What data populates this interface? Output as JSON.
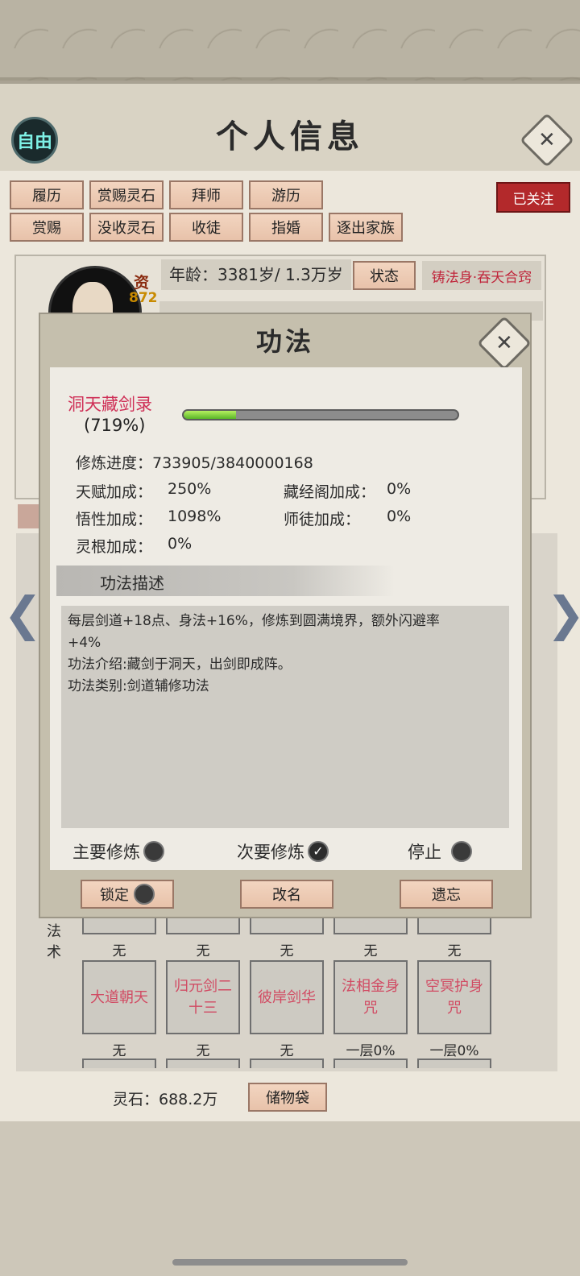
{
  "header": {
    "mode_badge": "自由",
    "title": "个人信息"
  },
  "actions": {
    "row1": [
      "履历",
      "赏赐灵石",
      "拜师",
      "游历"
    ],
    "row2": [
      "赏赐",
      "没收灵石",
      "收徒",
      "指婚",
      "逐出家族"
    ],
    "followed": "已关注"
  },
  "profile": {
    "zi_label": "资",
    "zi_value": "872",
    "age": "年龄：3381岁/ 1.3万岁",
    "status_button": "状态",
    "realm": "铸法身·吞天合窍"
  },
  "dialog": {
    "title": "功法",
    "skill_name": "洞天藏剑录",
    "skill_percent": "(719%)",
    "progress_fraction": 0.19,
    "stats": {
      "progress": "修炼进度：733905/3840000168",
      "talent": "天赋加成：",
      "talent_val": "250%",
      "library": "藏经阁加成：",
      "library_val": "0%",
      "insight": "悟性加成：",
      "insight_val": "1098%",
      "mentor": "师徒加成：",
      "mentor_val": "0%",
      "root": "灵根加成：",
      "root_val": "0%"
    },
    "description_header": "功法描述",
    "description_lines": [
      "每层剑道+18点、身法+16%，修炼到圆满境界，额外闪避率",
      "+4%",
      "功法介绍:藏剑于洞天，出剑即成阵。",
      "功法类别:剑道辅修功法"
    ],
    "modes": {
      "primary": "主要修炼",
      "secondary": "次要修炼",
      "stop": "停止",
      "selected": "secondary"
    },
    "buttons": {
      "lock": "锁定",
      "rename": "改名",
      "forget": "遗忘"
    }
  },
  "skills_grid": {
    "label": "法术",
    "row0_captions": [
      "无",
      "无",
      "无",
      "无",
      "无"
    ],
    "row1": [
      {
        "name": "大道朝天",
        "caption": "无"
      },
      {
        "name": "归元剑二十三",
        "caption": "无"
      },
      {
        "name": "彼岸剑华",
        "caption": "无"
      },
      {
        "name": "法相金身咒",
        "caption": "一层0%"
      },
      {
        "name": "空冥护身咒",
        "caption": "一层0%"
      }
    ]
  },
  "footer": {
    "spirit_stones": "灵石：688.2万",
    "bag_button": "储物袋"
  }
}
